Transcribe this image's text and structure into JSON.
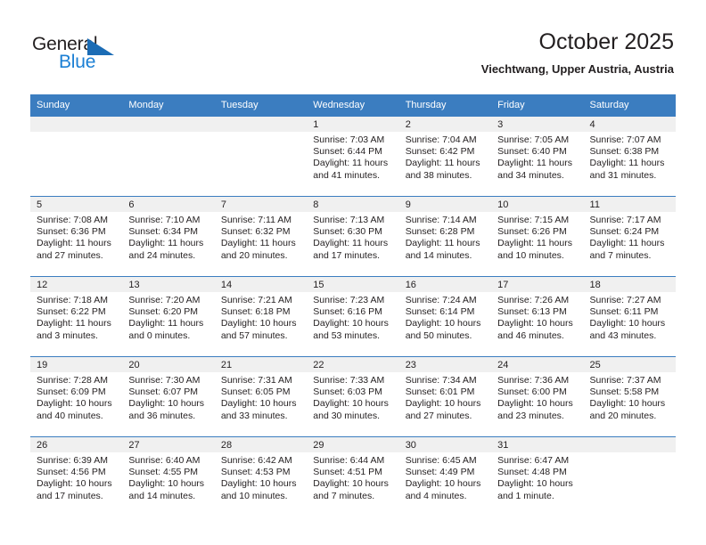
{
  "brand": {
    "name_part1": "General",
    "name_part2": "Blue",
    "accent_color": "#1b7fd4",
    "triangle_color": "#1b6cb5"
  },
  "header": {
    "title": "October 2025",
    "subtitle": "Viechtwang, Upper Austria, Austria"
  },
  "calendar": {
    "header_bg": "#3b7dc0",
    "daynum_bg": "#f0f0f0",
    "weekday_headers": [
      "Sunday",
      "Monday",
      "Tuesday",
      "Wednesday",
      "Thursday",
      "Friday",
      "Saturday"
    ],
    "weeks": [
      [
        {
          "day": "",
          "empty": true
        },
        {
          "day": "",
          "empty": true
        },
        {
          "day": "",
          "empty": true
        },
        {
          "day": "1",
          "sunrise": "Sunrise: 7:03 AM",
          "sunset": "Sunset: 6:44 PM",
          "daylight_line1": "Daylight: 11 hours",
          "daylight_line2": "and 41 minutes."
        },
        {
          "day": "2",
          "sunrise": "Sunrise: 7:04 AM",
          "sunset": "Sunset: 6:42 PM",
          "daylight_line1": "Daylight: 11 hours",
          "daylight_line2": "and 38 minutes."
        },
        {
          "day": "3",
          "sunrise": "Sunrise: 7:05 AM",
          "sunset": "Sunset: 6:40 PM",
          "daylight_line1": "Daylight: 11 hours",
          "daylight_line2": "and 34 minutes."
        },
        {
          "day": "4",
          "sunrise": "Sunrise: 7:07 AM",
          "sunset": "Sunset: 6:38 PM",
          "daylight_line1": "Daylight: 11 hours",
          "daylight_line2": "and 31 minutes."
        }
      ],
      [
        {
          "day": "5",
          "sunrise": "Sunrise: 7:08 AM",
          "sunset": "Sunset: 6:36 PM",
          "daylight_line1": "Daylight: 11 hours",
          "daylight_line2": "and 27 minutes."
        },
        {
          "day": "6",
          "sunrise": "Sunrise: 7:10 AM",
          "sunset": "Sunset: 6:34 PM",
          "daylight_line1": "Daylight: 11 hours",
          "daylight_line2": "and 24 minutes."
        },
        {
          "day": "7",
          "sunrise": "Sunrise: 7:11 AM",
          "sunset": "Sunset: 6:32 PM",
          "daylight_line1": "Daylight: 11 hours",
          "daylight_line2": "and 20 minutes."
        },
        {
          "day": "8",
          "sunrise": "Sunrise: 7:13 AM",
          "sunset": "Sunset: 6:30 PM",
          "daylight_line1": "Daylight: 11 hours",
          "daylight_line2": "and 17 minutes."
        },
        {
          "day": "9",
          "sunrise": "Sunrise: 7:14 AM",
          "sunset": "Sunset: 6:28 PM",
          "daylight_line1": "Daylight: 11 hours",
          "daylight_line2": "and 14 minutes."
        },
        {
          "day": "10",
          "sunrise": "Sunrise: 7:15 AM",
          "sunset": "Sunset: 6:26 PM",
          "daylight_line1": "Daylight: 11 hours",
          "daylight_line2": "and 10 minutes."
        },
        {
          "day": "11",
          "sunrise": "Sunrise: 7:17 AM",
          "sunset": "Sunset: 6:24 PM",
          "daylight_line1": "Daylight: 11 hours",
          "daylight_line2": "and 7 minutes."
        }
      ],
      [
        {
          "day": "12",
          "sunrise": "Sunrise: 7:18 AM",
          "sunset": "Sunset: 6:22 PM",
          "daylight_line1": "Daylight: 11 hours",
          "daylight_line2": "and 3 minutes."
        },
        {
          "day": "13",
          "sunrise": "Sunrise: 7:20 AM",
          "sunset": "Sunset: 6:20 PM",
          "daylight_line1": "Daylight: 11 hours",
          "daylight_line2": "and 0 minutes."
        },
        {
          "day": "14",
          "sunrise": "Sunrise: 7:21 AM",
          "sunset": "Sunset: 6:18 PM",
          "daylight_line1": "Daylight: 10 hours",
          "daylight_line2": "and 57 minutes."
        },
        {
          "day": "15",
          "sunrise": "Sunrise: 7:23 AM",
          "sunset": "Sunset: 6:16 PM",
          "daylight_line1": "Daylight: 10 hours",
          "daylight_line2": "and 53 minutes."
        },
        {
          "day": "16",
          "sunrise": "Sunrise: 7:24 AM",
          "sunset": "Sunset: 6:14 PM",
          "daylight_line1": "Daylight: 10 hours",
          "daylight_line2": "and 50 minutes."
        },
        {
          "day": "17",
          "sunrise": "Sunrise: 7:26 AM",
          "sunset": "Sunset: 6:13 PM",
          "daylight_line1": "Daylight: 10 hours",
          "daylight_line2": "and 46 minutes."
        },
        {
          "day": "18",
          "sunrise": "Sunrise: 7:27 AM",
          "sunset": "Sunset: 6:11 PM",
          "daylight_line1": "Daylight: 10 hours",
          "daylight_line2": "and 43 minutes."
        }
      ],
      [
        {
          "day": "19",
          "sunrise": "Sunrise: 7:28 AM",
          "sunset": "Sunset: 6:09 PM",
          "daylight_line1": "Daylight: 10 hours",
          "daylight_line2": "and 40 minutes."
        },
        {
          "day": "20",
          "sunrise": "Sunrise: 7:30 AM",
          "sunset": "Sunset: 6:07 PM",
          "daylight_line1": "Daylight: 10 hours",
          "daylight_line2": "and 36 minutes."
        },
        {
          "day": "21",
          "sunrise": "Sunrise: 7:31 AM",
          "sunset": "Sunset: 6:05 PM",
          "daylight_line1": "Daylight: 10 hours",
          "daylight_line2": "and 33 minutes."
        },
        {
          "day": "22",
          "sunrise": "Sunrise: 7:33 AM",
          "sunset": "Sunset: 6:03 PM",
          "daylight_line1": "Daylight: 10 hours",
          "daylight_line2": "and 30 minutes."
        },
        {
          "day": "23",
          "sunrise": "Sunrise: 7:34 AM",
          "sunset": "Sunset: 6:01 PM",
          "daylight_line1": "Daylight: 10 hours",
          "daylight_line2": "and 27 minutes."
        },
        {
          "day": "24",
          "sunrise": "Sunrise: 7:36 AM",
          "sunset": "Sunset: 6:00 PM",
          "daylight_line1": "Daylight: 10 hours",
          "daylight_line2": "and 23 minutes."
        },
        {
          "day": "25",
          "sunrise": "Sunrise: 7:37 AM",
          "sunset": "Sunset: 5:58 PM",
          "daylight_line1": "Daylight: 10 hours",
          "daylight_line2": "and 20 minutes."
        }
      ],
      [
        {
          "day": "26",
          "sunrise": "Sunrise: 6:39 AM",
          "sunset": "Sunset: 4:56 PM",
          "daylight_line1": "Daylight: 10 hours",
          "daylight_line2": "and 17 minutes."
        },
        {
          "day": "27",
          "sunrise": "Sunrise: 6:40 AM",
          "sunset": "Sunset: 4:55 PM",
          "daylight_line1": "Daylight: 10 hours",
          "daylight_line2": "and 14 minutes."
        },
        {
          "day": "28",
          "sunrise": "Sunrise: 6:42 AM",
          "sunset": "Sunset: 4:53 PM",
          "daylight_line1": "Daylight: 10 hours",
          "daylight_line2": "and 10 minutes."
        },
        {
          "day": "29",
          "sunrise": "Sunrise: 6:44 AM",
          "sunset": "Sunset: 4:51 PM",
          "daylight_line1": "Daylight: 10 hours",
          "daylight_line2": "and 7 minutes."
        },
        {
          "day": "30",
          "sunrise": "Sunrise: 6:45 AM",
          "sunset": "Sunset: 4:49 PM",
          "daylight_line1": "Daylight: 10 hours",
          "daylight_line2": "and 4 minutes."
        },
        {
          "day": "31",
          "sunrise": "Sunrise: 6:47 AM",
          "sunset": "Sunset: 4:48 PM",
          "daylight_line1": "Daylight: 10 hours",
          "daylight_line2": "and 1 minute."
        },
        {
          "day": "",
          "empty": true
        }
      ]
    ]
  }
}
